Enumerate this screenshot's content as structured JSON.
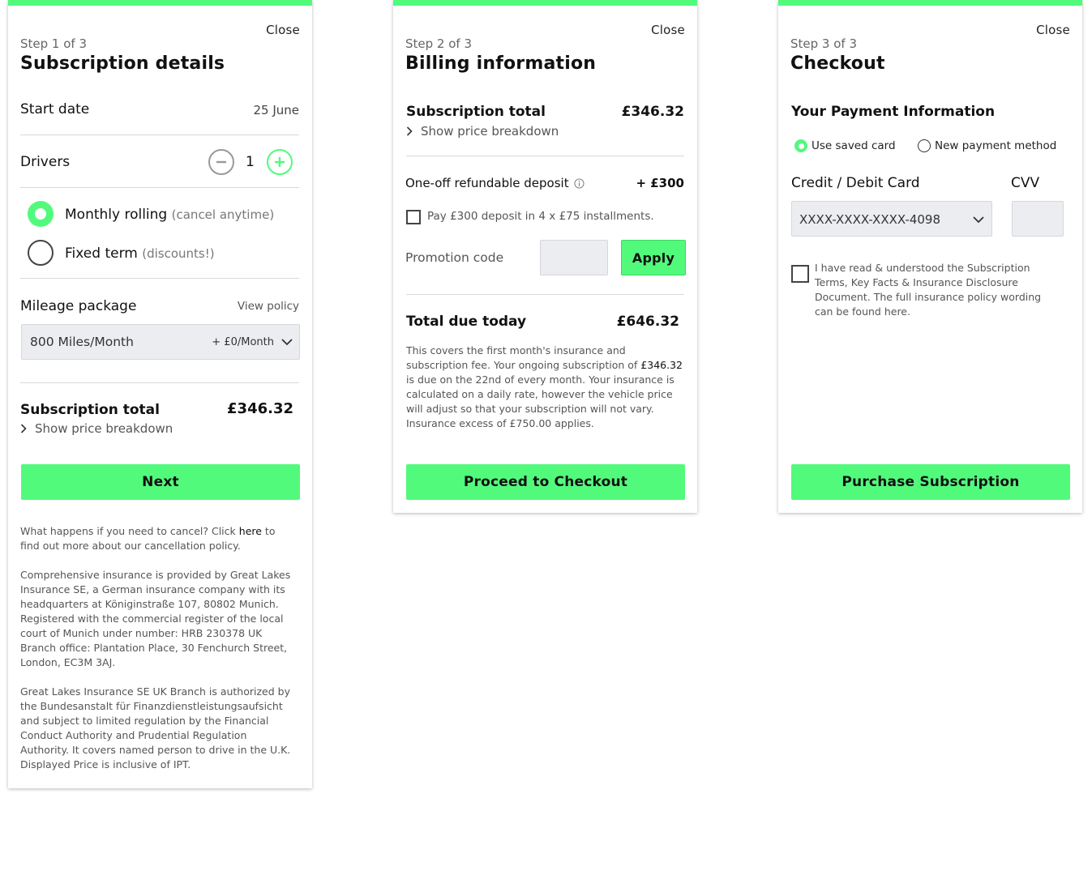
{
  "colors": {
    "accent": "#52fa7c",
    "input_bg": "#ecedf1"
  },
  "step1": {
    "close": "Close",
    "step": "Step 1 of 3",
    "title": "Subscription details",
    "start_date_label": "Start date",
    "start_date_value": "25 June",
    "drivers_label": "Drivers",
    "drivers_count": "1",
    "plan_monthly": "Monthly rolling",
    "plan_monthly_note": "(cancel anytime)",
    "plan_fixed": "Fixed term",
    "plan_fixed_note": "(discounts!)",
    "mileage_label": "Mileage package",
    "view_policy": "View policy",
    "mileage_value": "800 Miles/Month",
    "mileage_price": "+ £0/Month",
    "total_label": "Subscription total",
    "total_value": "£346.32",
    "breakdown": "Show price breakdown",
    "next": "Next",
    "cancel_text_pre": "What happens if you need to cancel? Click",
    "cancel_link": "here",
    "cancel_text_post": "to find out more about our cancellation policy.",
    "para1": "Comprehensive insurance is provided by Great Lakes Insurance SE, a German insurance company with its headquarters at Königinstraße 107, 80802 Munich. Registered with the commercial register of the local court of Munich under number: HRB 230378 UK Branch office: Plantation Place, 30 Fenchurch Street, London, EC3M 3AJ.",
    "para2": "Great Lakes Insurance SE UK Branch is authorized by the Bundesanstalt für Finanzdienstleistungsaufsicht and subject to limited regulation by the Financial Conduct Authority and Prudential Regulation Authority. It covers named person to drive in the U.K. Displayed Price is inclusive of IPT."
  },
  "step2": {
    "close": "Close",
    "step": "Step 2 of 3",
    "title": "Billing information",
    "total_label": "Subscription total",
    "total_value": "£346.32",
    "breakdown": "Show price breakdown",
    "deposit_label": "One-off refundable deposit",
    "deposit_value": "+ £300",
    "installments": "Pay £300 deposit in 4 x £75 installments.",
    "promo_label": "Promotion code",
    "apply": "Apply",
    "due_label": "Total due today",
    "due_value": "£646.32",
    "note_pre": "This covers the first month's insurance and subscription fee. Your ongoing subscription of",
    "note_amount": "£346.32",
    "note_post": "is due on the 22nd of every month. Your insurance is calculated on a daily rate, however the vehicle price will adjust so that your subscription will not vary. Insurance excess of £750.00 applies.",
    "proceed": "Proceed to Checkout"
  },
  "step3": {
    "close": "Close",
    "step": "Step 3 of 3",
    "title": "Checkout",
    "payment_heading": "Your Payment Information",
    "saved_card": "Use saved card",
    "new_method": "New payment method",
    "card_label": "Credit / Debit Card",
    "cvv_label": "CVV",
    "card_value": "XXXX-XXXX-XXXX-4098",
    "terms": "I have read & understood the Subscription Terms, Key Facts & Insurance Disclosure Document. The full insurance policy wording can be found here.",
    "purchase": "Purchase Subscription"
  },
  "icons": [
    "minus-circle-icon",
    "plus-circle-icon",
    "chevron-down-icon",
    "chevron-right-icon",
    "info-icon"
  ]
}
